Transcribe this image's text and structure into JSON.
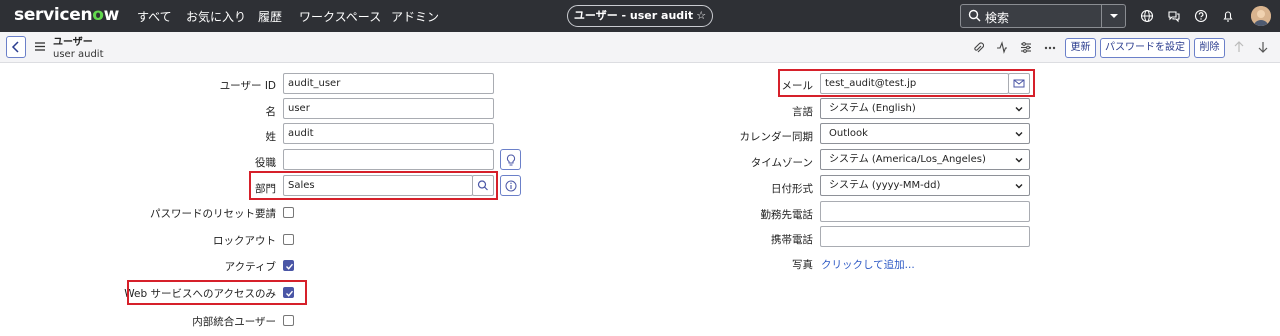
{
  "topnav": {
    "logo_main": "servicen",
    "logo_o": "o",
    "logo_end": "w",
    "items": [
      "すべて",
      "お気に入り",
      "履歴",
      "ワークスペース",
      "アドミン"
    ],
    "record_title": "ユーザー - user audit",
    "star": "☆",
    "search_placeholder": "検索",
    "icons": [
      "globe-icon",
      "chat-icon",
      "help-icon",
      "bell-icon"
    ]
  },
  "header": {
    "title": "ユーザー",
    "subtitle": "user audit",
    "buttons": {
      "update": "更新",
      "reset_password": "パスワードを設定",
      "delete": "削除"
    }
  },
  "form_left": {
    "user_id": {
      "label": "ユーザー ID",
      "value": "audit_user"
    },
    "first_name": {
      "label": "名",
      "value": "user"
    },
    "last_name": {
      "label": "姓",
      "value": "audit"
    },
    "title": {
      "label": "役職",
      "value": ""
    },
    "department": {
      "label": "部門",
      "value": "Sales"
    },
    "password_reset": {
      "label": "パスワードのリセット要請",
      "checked": false
    },
    "locked_out": {
      "label": "ロックアウト",
      "checked": false
    },
    "active": {
      "label": "アクティブ",
      "checked": true
    },
    "web_service_only": {
      "label": "Web サービスへのアクセスのみ",
      "checked": true
    },
    "internal_integration": {
      "label": "内部統合ユーザー",
      "checked": false
    }
  },
  "form_right": {
    "email": {
      "label": "メール",
      "value": "test_audit@test.jp"
    },
    "language": {
      "label": "言語",
      "value": "システム (English)"
    },
    "calendar_sync": {
      "label": "カレンダー同期",
      "value": "Outlook"
    },
    "timezone": {
      "label": "タイムゾーン",
      "value": "システム (America/Los_Angeles)"
    },
    "date_format": {
      "label": "日付形式",
      "value": "システム (yyyy-MM-dd)"
    },
    "business_phone": {
      "label": "勤務先電話",
      "value": ""
    },
    "mobile_phone": {
      "label": "携帯電話",
      "value": ""
    },
    "photo": {
      "label": "写真",
      "link": "クリックして追加..."
    }
  },
  "colors": {
    "nav_bg": "#2e3035",
    "accent": "#4a56a6",
    "highlight": "#d6202a",
    "logo_green": "#62d84e"
  }
}
